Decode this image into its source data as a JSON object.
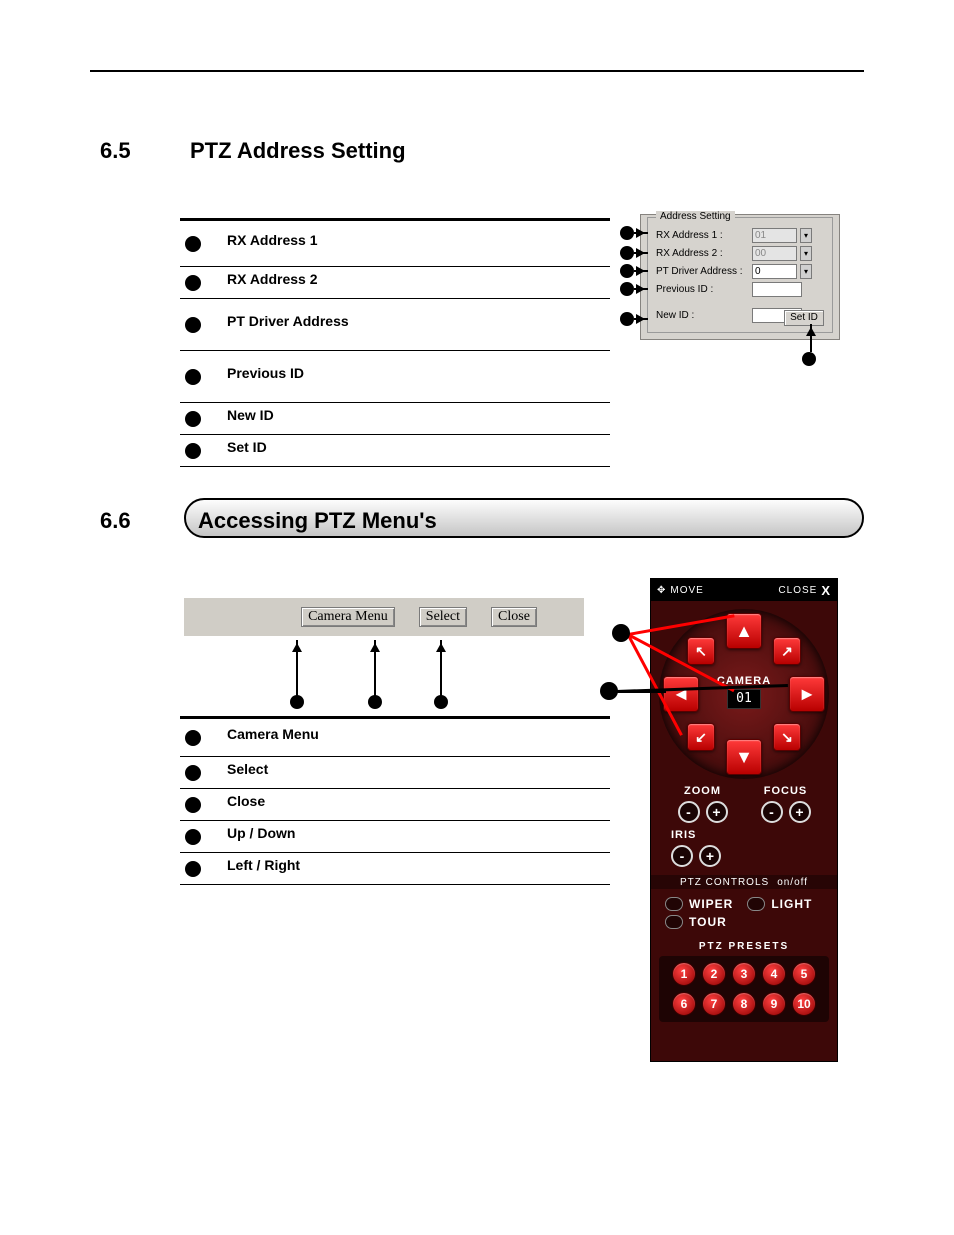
{
  "section65": {
    "number": "6.5",
    "title": "PTZ Address Setting"
  },
  "table65": {
    "items": [
      {
        "label": "RX Address 1"
      },
      {
        "label": "RX Address 2"
      },
      {
        "label": "PT Driver Address"
      },
      {
        "label": "Previous ID"
      },
      {
        "label": "New ID"
      },
      {
        "label": "Set ID"
      }
    ]
  },
  "address_panel": {
    "group": "Address Setting",
    "rows": {
      "rx1": {
        "label": "RX Address 1 :",
        "value": "01"
      },
      "rx2": {
        "label": "RX Address 2 :",
        "value": "00"
      },
      "ptd": {
        "label": "PT Driver Address  :",
        "value": "0"
      },
      "prev": {
        "label": "Previous ID :",
        "value": ""
      },
      "newid": {
        "label": "New ID :",
        "value": ""
      }
    },
    "button": "Set ID"
  },
  "section66": {
    "number": "6.6",
    "title": "Accessing PTZ Menu's"
  },
  "menubar": {
    "camera_menu": "Camera Menu",
    "select": "Select",
    "close": "Close"
  },
  "table66": {
    "items": [
      {
        "label": "Camera Menu"
      },
      {
        "label": "Select"
      },
      {
        "label": "Close"
      },
      {
        "label": "Up / Down"
      },
      {
        "label": "Left / Right"
      }
    ]
  },
  "ptz": {
    "move": "MOVE",
    "close": "CLOSE",
    "close_x": "X",
    "camera": "CAMERA",
    "cam_num": "01",
    "zoom": "ZOOM",
    "focus": "FOCUS",
    "iris": "IRIS",
    "controls": "PTZ CONTROLS",
    "onoff": "on/off",
    "wiper": "WIPER",
    "light": "LIGHT",
    "tour": "TOUR",
    "presets_label": "PTZ PRESETS",
    "presets": [
      "1",
      "2",
      "3",
      "4",
      "5",
      "6",
      "7",
      "8",
      "9",
      "10"
    ],
    "minus": "-",
    "plus": "+",
    "arrows": {
      "up": "▲",
      "down": "▼",
      "left": "◄",
      "right": "►",
      "ul": "↖",
      "ur": "↗",
      "dl": "↙",
      "dr": "↘"
    }
  }
}
